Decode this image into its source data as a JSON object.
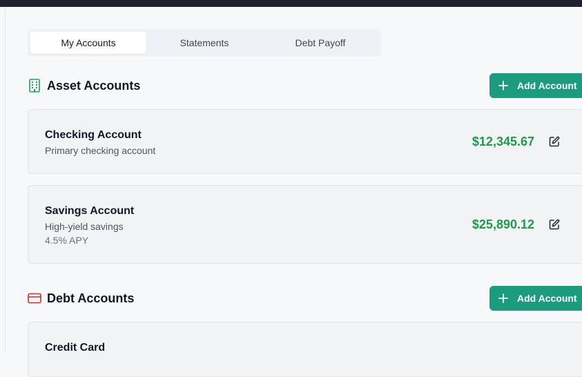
{
  "tabs": [
    {
      "label": "My Accounts",
      "active": true
    },
    {
      "label": "Statements",
      "active": false
    },
    {
      "label": "Debt Payoff",
      "active": false
    }
  ],
  "asset_section": {
    "title": "Asset Accounts",
    "icon": "building-icon",
    "add_label": "Add Account",
    "accounts": [
      {
        "name": "Checking Account",
        "description": "Primary checking account",
        "amount": "$12,345.67"
      },
      {
        "name": "Savings Account",
        "description": "High-yield savings",
        "extra": "4.5% APY",
        "amount": "$25,890.12"
      }
    ]
  },
  "debt_section": {
    "title": "Debt Accounts",
    "icon": "credit-card-icon",
    "add_label": "Add Account",
    "accounts": [
      {
        "name": "Credit Card"
      }
    ]
  },
  "colors": {
    "accent": "#1c9c7f",
    "amount_positive": "#1e9a4f",
    "asset_icon": "#22a05a",
    "debt_icon": "#dc2626"
  }
}
